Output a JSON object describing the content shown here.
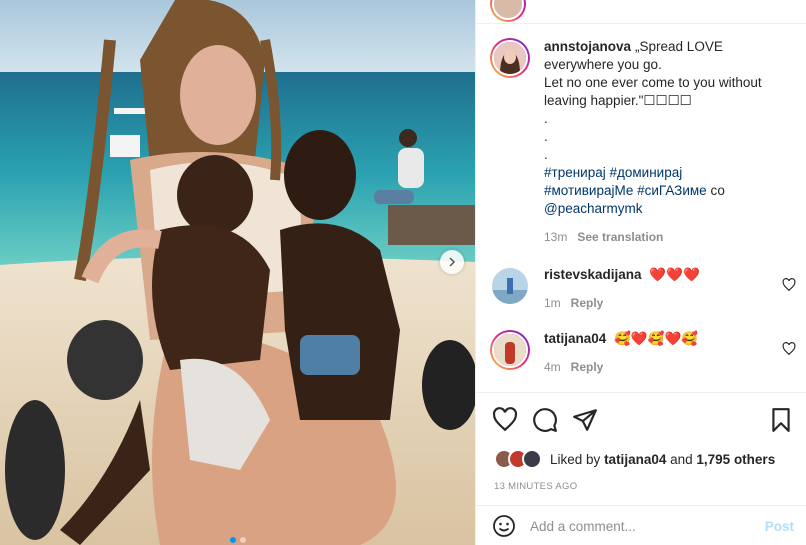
{
  "post": {
    "author": "annstojanova",
    "caption_lines": [
      "„Spread LOVE",
      "everywhere you go.",
      "Let no one ever come to you without",
      "leaving happier.\"☐☐☐☐"
    ],
    "dots": [
      ".",
      ".",
      "."
    ],
    "hashtags_line1": [
      "#тренирај",
      "#доминирај"
    ],
    "hashtags_line2": [
      "#мотивирајМе",
      "#сиГАЗиме"
    ],
    "hashtag_connector": "со",
    "mention": "@peacharmymk",
    "time": "13m",
    "see_translation": "See translation"
  },
  "comments": [
    {
      "username": "ristevskadijana",
      "text": "❤️❤️❤️",
      "time": "1m",
      "reply": "Reply"
    },
    {
      "username": "tatijana04",
      "text": "🥰❤️🥰❤️🥰",
      "time": "4m",
      "reply": "Reply"
    }
  ],
  "likes": {
    "prefix": "Liked by",
    "user": "tatijana04",
    "and": "and",
    "others": "1,795 others"
  },
  "timestamp": "13 MINUTES AGO",
  "add_comment": {
    "placeholder": "Add a comment...",
    "post_label": "Post"
  },
  "colors": {
    "link": "#00376b",
    "post_disabled": "#b2dffc",
    "muted": "#8e8e8e"
  },
  "carousel": {
    "total": 2,
    "active": 1
  }
}
